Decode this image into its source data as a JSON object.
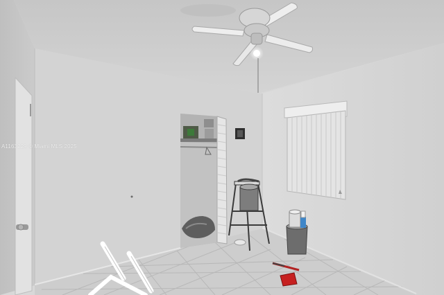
{
  "photo": {
    "watermark": "A1163229 © Miami MLS 2025"
  },
  "palette": {
    "ceiling": "#cfcfcf",
    "wall_back": "#d5d5d5",
    "wall_left": "#c7c7c7",
    "wall_right": "#d9d9d9",
    "floor_tile": "#cecece",
    "grout": "#b9b9b9",
    "closet_dark": "#a9a9a9",
    "blind": "#e8e8e8"
  }
}
